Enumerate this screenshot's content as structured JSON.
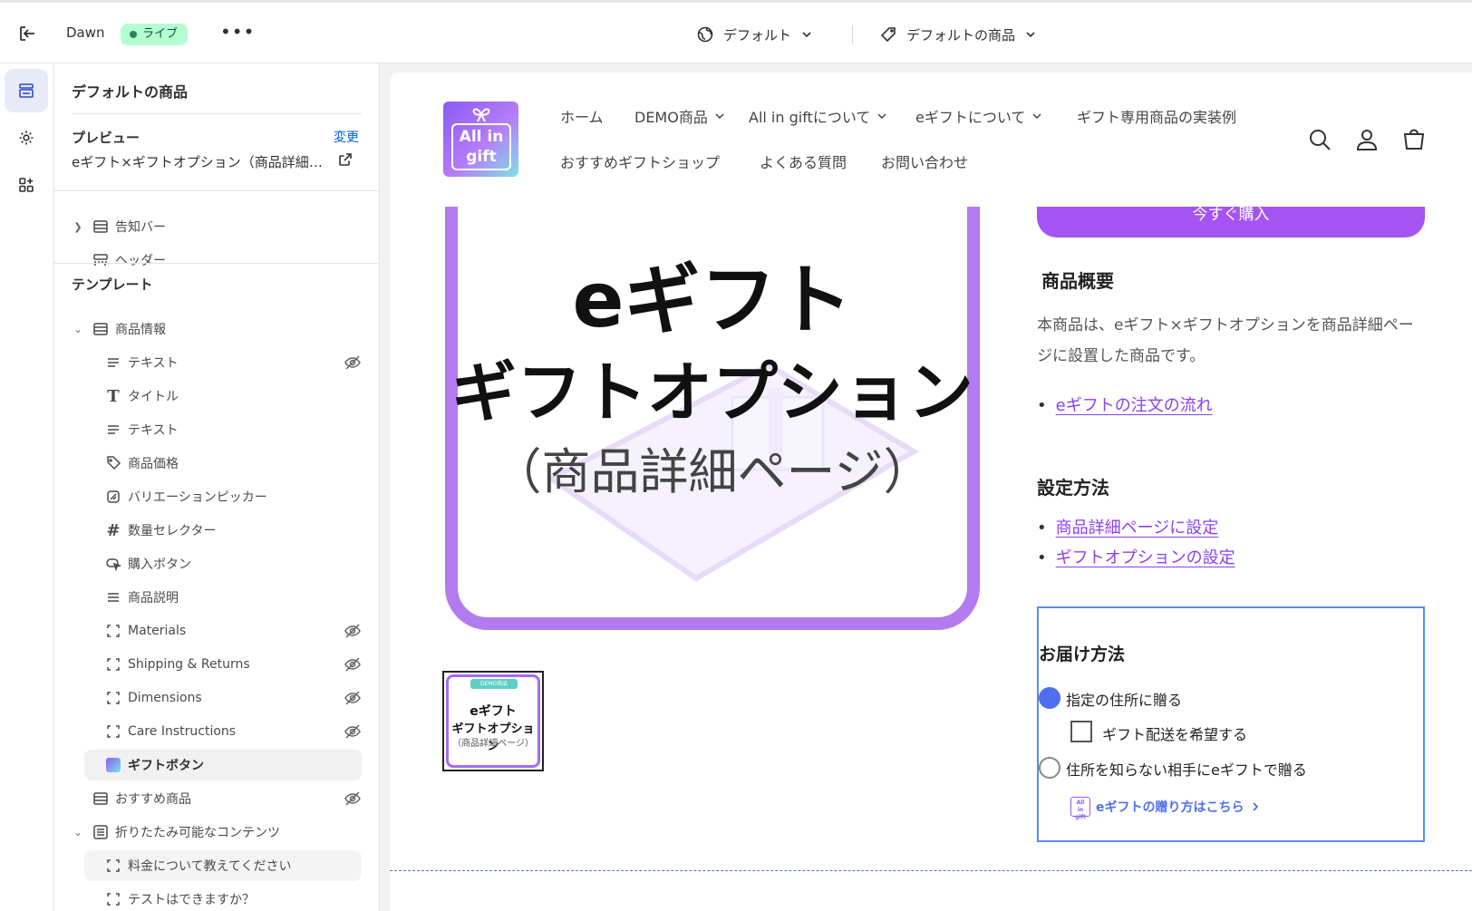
{
  "topbar": {
    "theme_name": "Dawn",
    "live_label": "ライブ",
    "more_label": "•••",
    "language_selector": "デフォルト",
    "template_selector": "デフォルトの商品"
  },
  "sidebar": {
    "title": "デフォルトの商品",
    "preview_label": "プレビュー",
    "preview_change": "変更",
    "preview_value": "eギフト×ギフトオプション（商品詳細ページ）",
    "items": [
      {
        "label": "告知バー"
      },
      {
        "label": "ヘッダー"
      }
    ],
    "template_label": "テンプレート",
    "product_info": "商品情報",
    "blocks": [
      {
        "label": "テキスト"
      },
      {
        "label": "タイトル"
      },
      {
        "label": "テキスト"
      },
      {
        "label": "商品価格"
      },
      {
        "label": "バリエーションピッカー"
      },
      {
        "label": "数量セレクター"
      },
      {
        "label": "購入ボタン"
      },
      {
        "label": "商品説明"
      },
      {
        "label": "Materials"
      },
      {
        "label": "Shipping & Returns"
      },
      {
        "label": "Dimensions"
      },
      {
        "label": "Care Instructions"
      },
      {
        "label": "ギフトボタン"
      }
    ],
    "recommended": "おすすめ商品",
    "collapsible": "折りたたみ可能なコンテンツ",
    "collapsible_items": [
      {
        "label": "料金について教えてください"
      },
      {
        "label": "テストはできますか？"
      }
    ]
  },
  "store": {
    "logo_line1": "All in",
    "logo_line2": "gift",
    "nav": [
      "ホーム",
      "DEMO商品",
      "All in giftについて",
      "eギフトについて",
      "ギフト専用商品の実装例",
      "おすすめギフトショップ",
      "よくある質問",
      "お問い合わせ"
    ],
    "hero_line1": "eギフト",
    "hero_line2": "ギフトオプション",
    "hero_line3": "（商品詳細ページ）",
    "thumb_badge": "DEMO商品",
    "thumb_line1": "eギフト",
    "thumb_line2": "ギフトオプション",
    "thumb_line3": "（商品詳細ページ）",
    "buy_label": "今すぐ購入",
    "overview_heading": "商品概要",
    "description": "本商品は、eギフト×ギフトオプションを商品詳細ページに設置した商品です。",
    "link_order_flow": "eギフトの注文の流れ",
    "setting_heading": "設定方法",
    "link_setting_product": "商品詳細ページに設定",
    "link_setting_option": "ギフトオプションの設定",
    "delivery": {
      "title": "お届け方法",
      "option1": "指定の住所に贈る",
      "checkbox": "ギフト配送を希望する",
      "option2": "住所を知らない相手にeギフトで贈る",
      "link": "eギフトの贈り方はこちら"
    }
  },
  "colors": {
    "accent": "#a553f3",
    "link": "#8a3ff0",
    "radio": "#4f6ff0",
    "live_badge": "#b4fed2"
  }
}
